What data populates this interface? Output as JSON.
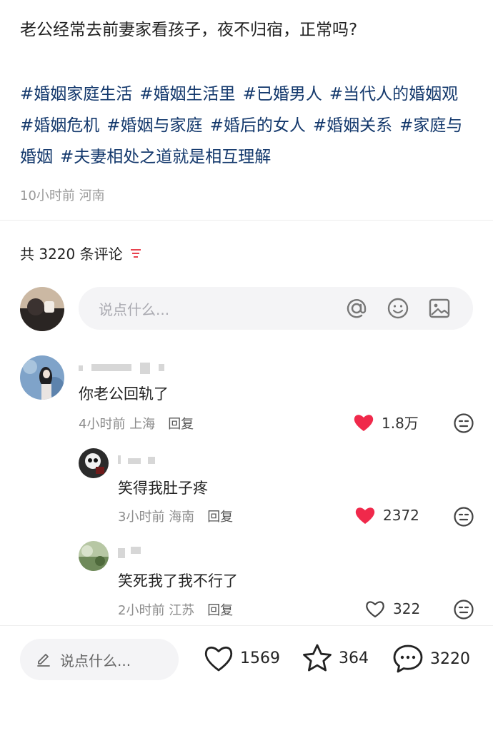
{
  "post": {
    "title": "老公经常去前妻家看孩子，夜不归宿，正常吗?",
    "tags": [
      "#婚姻家庭生活",
      "#婚姻生活里",
      "#已婚男人",
      "#当代人的婚姻观",
      "#婚姻危机",
      "#婚姻与家庭",
      "#婚后的女人",
      "#婚姻关系",
      "#家庭与婚姻",
      "#夫妻相处之道就是相互理解"
    ],
    "time": "10小时前",
    "location": "河南"
  },
  "comments_header": {
    "label": "共 3220 条评论"
  },
  "composer": {
    "placeholder": "说点什么..."
  },
  "comments": [
    {
      "text": "你老公回轨了",
      "time": "4小时前",
      "location": "上海",
      "reply": "回复",
      "likes": "1.8万",
      "liked": true
    },
    {
      "text": "笑得我肚子疼",
      "time": "3小时前",
      "location": "海南",
      "reply": "回复",
      "likes": "2372",
      "liked": true
    },
    {
      "text": "笑死我了我不行了",
      "time": "2小时前",
      "location": "江苏",
      "reply": "回复",
      "likes": "322",
      "liked": false
    }
  ],
  "bottom_bar": {
    "placeholder": "说点什么...",
    "likes": "1569",
    "favorites": "364",
    "comments": "3220"
  },
  "colors": {
    "tag": "#13386c",
    "like_red": "#f0294b",
    "meta": "#9a9a9a"
  }
}
